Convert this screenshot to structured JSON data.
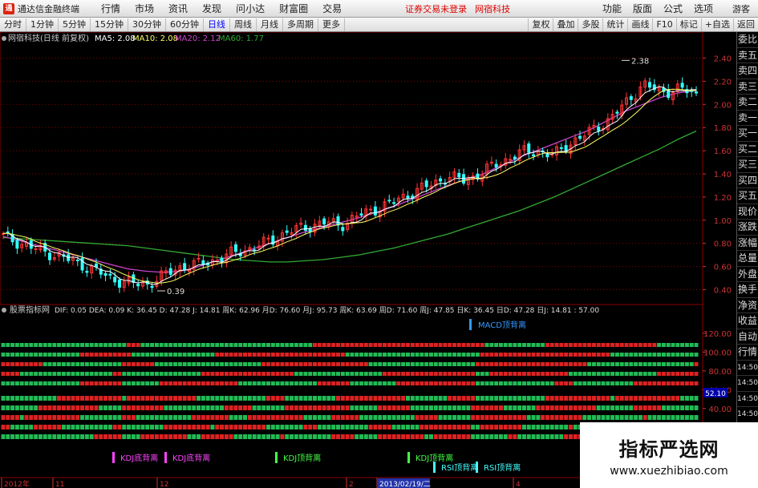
{
  "titlebar": {
    "app_name": "通达信金融终端",
    "menus": [
      "行情",
      "市场",
      "资讯",
      "发现",
      "问小达",
      "财富圈",
      "交易"
    ],
    "notice": "证券交易未登录",
    "notice2": "网宿科技",
    "right_menus": [
      "功能",
      "版面",
      "公式",
      "选项"
    ],
    "guest": "游客"
  },
  "periodbar": {
    "tabs": [
      "分时",
      "1分钟",
      "5分钟",
      "15分钟",
      "30分钟",
      "60分钟",
      "日线",
      "周线",
      "月线",
      "多周期",
      "更多"
    ],
    "active_tab": "日线",
    "tools": [
      "复权",
      "叠加",
      "多股",
      "统计",
      "画线",
      "F10",
      "标记",
      "+自选",
      "返回"
    ]
  },
  "main_legend": {
    "stock": "网宿科技(日线 前复权)",
    "ma5": "MA5: 2.08",
    "ma10": "MA10: 2.08",
    "ma20": "MA20: 2.12",
    "ma60": "MA60: 1.77"
  },
  "price_axis": [
    "2.40",
    "2.20",
    "2.00",
    "1.80",
    "1.60",
    "1.40",
    "1.20",
    "1.00",
    "0.80",
    "0.60",
    "0.40"
  ],
  "annotations": {
    "high": "2.38",
    "low": "0.39"
  },
  "indicator_legend": {
    "name": "股票指标网",
    "text": "DIF: 0.05  DEA: 0.09  K: 36.45  D: 47.28  J: 14.81  周K: 62.96  月D: 76.60  月J: 95.73  周K: 63.69  周D: 71.60  周J: 47.85  日K: 36.45  日D: 47.28  日J: 14.81 : 57.00"
  },
  "indicator_axis": [
    "120.00",
    "100.00",
    "80.00",
    "60.00",
    "40.00",
    "20.00"
  ],
  "indicator_value": "52.10",
  "signals": [
    {
      "text": "MACD顶背离",
      "color": "#3399ff"
    },
    {
      "text": "KDJ底背离",
      "color": "#ff44ff"
    },
    {
      "text": "KDJ底背离",
      "color": "#ff44ff"
    },
    {
      "text": "KDJ顶背离",
      "color": "#44ff44"
    },
    {
      "text": "KDJ顶背离",
      "color": "#44ff44"
    },
    {
      "text": "RSI顶背离",
      "color": "#44ffff"
    },
    {
      "text": "RSI顶背离",
      "color": "#44ffff"
    }
  ],
  "date_axis": [
    "2012年",
    "11",
    "12",
    "2",
    "2013/02/19/二",
    "4"
  ],
  "side_panel": [
    "委比",
    "卖五",
    "卖四",
    "卖三",
    "卖二",
    "卖一",
    "买一",
    "买二",
    "买三",
    "买四",
    "买五",
    "现价",
    "涨跌",
    "涨幅",
    "总量",
    "外盘",
    "换手",
    "净资",
    "收益",
    "自动",
    "行情",
    "14:50",
    "14:50",
    "14:50",
    "14:50",
    "14:50",
    "14:50"
  ],
  "watermark": {
    "title": "指标严选网",
    "url": "www.xuezhibiao.com"
  },
  "colors": {
    "ma5": "#ffffff",
    "ma10": "#ffff66",
    "ma20": "#cc44cc",
    "ma60": "#33aa33",
    "up": "#ff3333",
    "down": "#33ffff",
    "grid": "#8b0000"
  },
  "chart_data": {
    "type": "candlestick",
    "price_range": [
      0.3,
      2.5
    ],
    "ma60": [
      0.85,
      0.84,
      0.83,
      0.82,
      0.81,
      0.8,
      0.79,
      0.78,
      0.76,
      0.74,
      0.72,
      0.7,
      0.68,
      0.66,
      0.65,
      0.64,
      0.64,
      0.65,
      0.66,
      0.68,
      0.7,
      0.73,
      0.76,
      0.8,
      0.84,
      0.88,
      0.93,
      0.98,
      1.03,
      1.08,
      1.14,
      1.2,
      1.27,
      1.34,
      1.41,
      1.48,
      1.55,
      1.62,
      1.7,
      1.77
    ],
    "ma20": [
      0.86,
      0.82,
      0.78,
      0.74,
      0.7,
      0.66,
      0.62,
      0.58,
      0.56,
      0.55,
      0.56,
      0.6,
      0.65,
      0.7,
      0.75,
      0.8,
      0.85,
      0.9,
      0.94,
      0.98,
      1.02,
      1.07,
      1.12,
      1.18,
      1.24,
      1.3,
      1.35,
      1.4,
      1.47,
      1.54,
      1.6,
      1.66,
      1.72,
      1.78,
      1.86,
      1.94,
      2.0,
      2.06,
      2.1,
      2.12
    ],
    "closes": [
      0.86,
      0.8,
      0.74,
      0.7,
      0.64,
      0.58,
      0.5,
      0.46,
      0.44,
      0.52,
      0.6,
      0.62,
      0.66,
      0.72,
      0.76,
      0.82,
      0.9,
      0.94,
      0.98,
      0.96,
      1.04,
      1.1,
      1.16,
      1.24,
      1.3,
      1.38,
      1.34,
      1.42,
      1.5,
      1.58,
      1.6,
      1.56,
      1.68,
      1.76,
      1.86,
      2.0,
      2.18,
      2.1,
      2.14,
      2.08
    ]
  }
}
